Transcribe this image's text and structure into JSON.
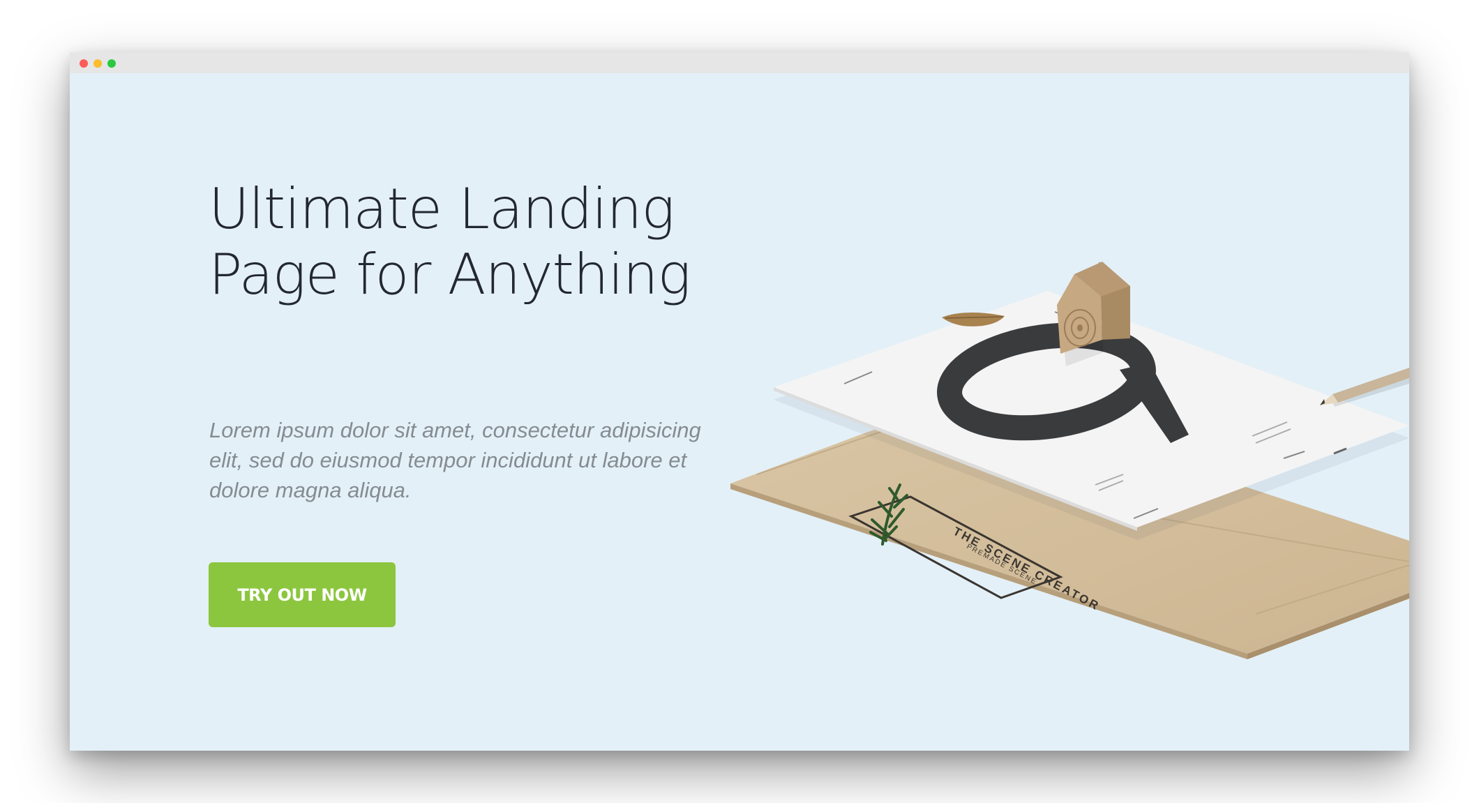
{
  "window": {
    "controls": [
      "close",
      "minimize",
      "maximize"
    ]
  },
  "hero": {
    "headline": "Ultimate Landing Page for Anything",
    "subtext": "Lorem ipsum dolor sit amet, consectetur adipisicing elit, sed do eiusmod tempor incididunt ut labore et dolore magna aliqua.",
    "cta_label": "TRY OUT NOW"
  },
  "scene": {
    "stamp_title": "THE SCENE CREATOR",
    "stamp_subtitle": "PREMADE SCENE"
  },
  "colors": {
    "page_background": "#e3f0f8",
    "accent": "#8cc63f",
    "headline": "#232730",
    "subtext": "#858b91"
  }
}
